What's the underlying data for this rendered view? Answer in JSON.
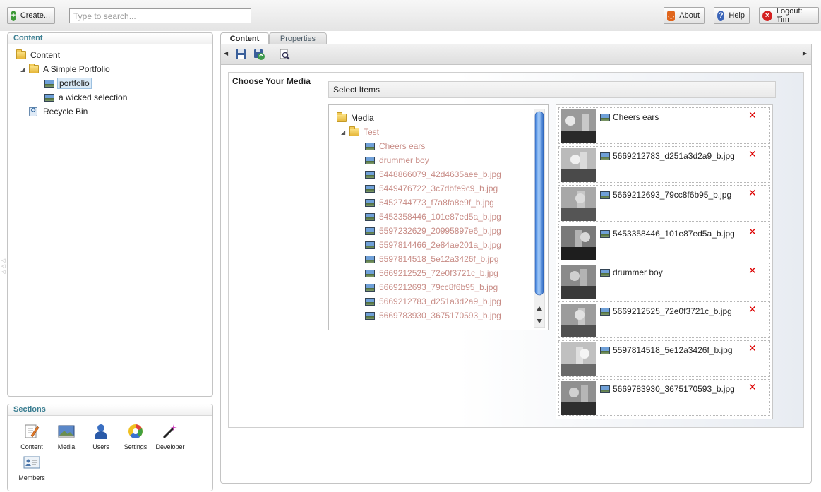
{
  "topbar": {
    "create_label": "Create...",
    "search_placeholder": "Type to search...",
    "about_label": "About",
    "help_label": "Help",
    "logout_label": "Logout: Tim"
  },
  "content_panel": {
    "title": "Content",
    "tree": {
      "root": "Content",
      "portfolio_root": "A Simple Portfolio",
      "child_portfolio": "portfolio",
      "child_selection": "a wicked selection",
      "recycle_bin": "Recycle Bin"
    }
  },
  "sections_panel": {
    "title": "Sections",
    "items": [
      "Content",
      "Media",
      "Users",
      "Settings",
      "Developer",
      "Members"
    ]
  },
  "tabs": [
    "Content",
    "Properties"
  ],
  "editor": {
    "field_label": "Choose Your Media",
    "select_header": "Select Items",
    "media_tree": {
      "root": "Media",
      "folder": "Test",
      "items": [
        "Cheers ears",
        "drummer boy",
        "5448866079_42d4635aee_b.jpg",
        "5449476722_3c7dbfe9c9_b.jpg",
        "5452744773_f7a8fa8e9f_b.jpg",
        "5453358446_101e87ed5a_b.jpg",
        "5597232629_20995897e6_b.jpg",
        "5597814466_2e84ae201a_b.jpg",
        "5597814518_5e12a3426f_b.jpg",
        "5669212525_72e0f3721c_b.jpg",
        "5669212693_79cc8f6b95_b.jpg",
        "5669212783_d251a3d2a9_b.jpg",
        "5669783930_3675170593_b.jpg"
      ]
    },
    "selected_items": [
      "Cheers ears",
      "5669212783_d251a3d2a9_b.jpg",
      "5669212693_79cc8f6b95_b.jpg",
      "5453358446_101e87ed5a_b.jpg",
      "drummer boy",
      "5669212525_72e0f3721c_b.jpg",
      "5597814518_5e12a3426f_b.jpg",
      "5669783930_3675170593_b.jpg"
    ]
  },
  "colors": {
    "section_title": "#3c7f92",
    "media_link": "#c88c86",
    "delete_icon": "#dd0000"
  }
}
